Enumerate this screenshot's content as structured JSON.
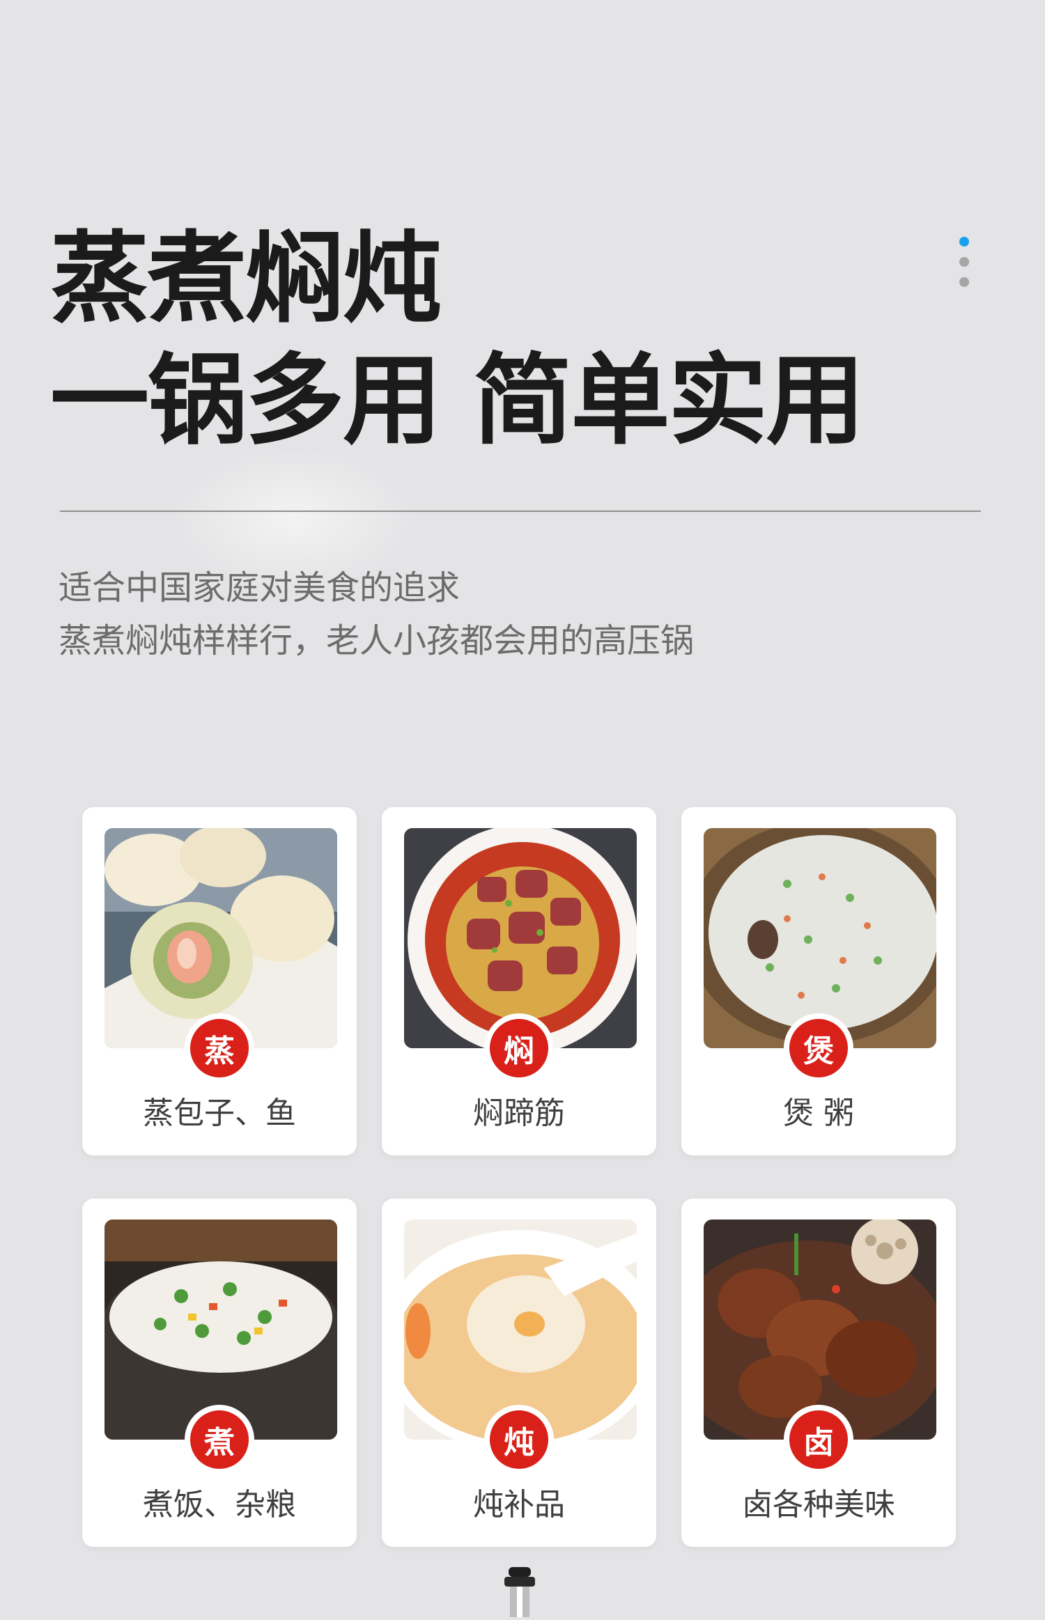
{
  "headline": {
    "line1": "蒸煮焖炖",
    "line2": "一锅多用  简单实用"
  },
  "pagination": {
    "count": 3,
    "active": 1,
    "active_color": "#19a1ee"
  },
  "description": {
    "line1": "适合中国家庭对美食的追求",
    "line2": "蒸煮焖炖样样行，老人小孩都会用的高压锅"
  },
  "accent_color": "#d92019",
  "functions": [
    {
      "badge": "蒸",
      "label": "蒸包子、鱼",
      "image": "steamed-buns-image"
    },
    {
      "badge": "焖",
      "label": "焖蹄筋",
      "image": "braised-tendon-image"
    },
    {
      "badge": "煲",
      "label": "煲 粥",
      "image": "congee-image"
    },
    {
      "badge": "煮",
      "label": "煮饭、杂粮",
      "image": "fried-rice-image"
    },
    {
      "badge": "炖",
      "label": "炖补品",
      "image": "bird-nest-soup-image"
    },
    {
      "badge": "卤",
      "label": "卤各种美味",
      "image": "braised-trotters-image"
    }
  ]
}
